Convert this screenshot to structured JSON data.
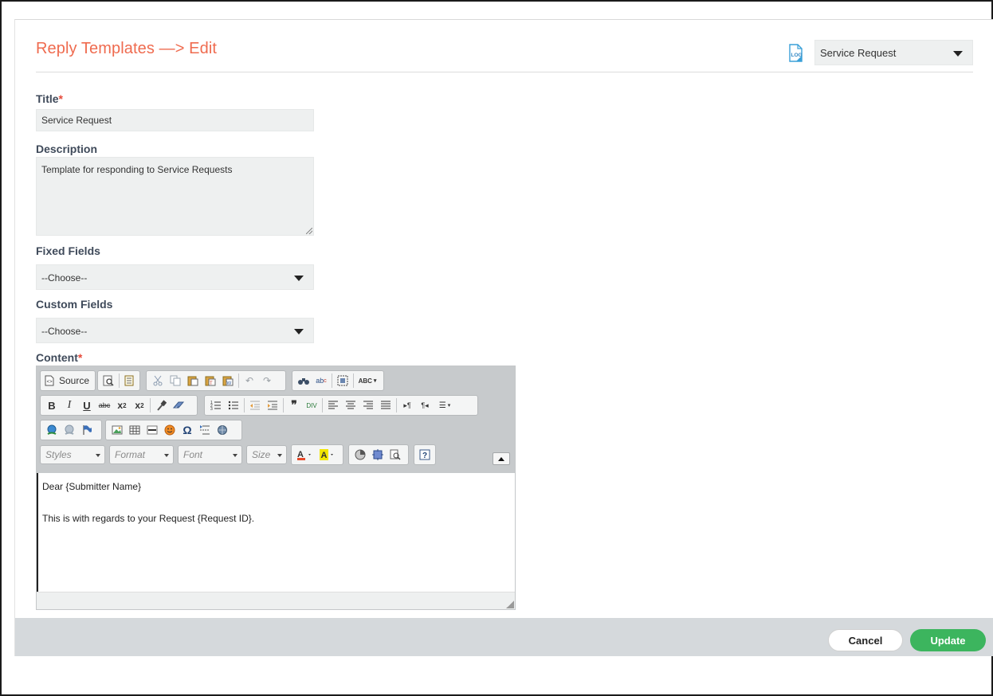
{
  "header": {
    "title": "Reply Templates —> Edit",
    "template_select_value": "Service Request"
  },
  "form": {
    "title_label": "Title",
    "title_value": "Service Request",
    "description_label": "Description",
    "description_value": "Template for responding to Service Requests",
    "fixed_fields_label": "Fixed Fields",
    "fixed_fields_value": "--Choose--",
    "custom_fields_label": "Custom Fields",
    "custom_fields_value": "--Choose--",
    "content_label": "Content",
    "required_mark": "*"
  },
  "editor": {
    "source_label": "Source",
    "styles_placeholder": "Styles",
    "format_placeholder": "Format",
    "font_placeholder": "Font",
    "size_placeholder": "Size",
    "content_line1": "Dear  {Submitter Name}",
    "content_line2": "This is with regards to your  Request {Request ID}."
  },
  "footer": {
    "cancel_label": "Cancel",
    "update_label": "Update"
  },
  "colors": {
    "title_accent": "#ef6b4f",
    "required": "#e64b3c",
    "update_button": "#3cb55e",
    "footer_bar": "#d5d9dc",
    "toolbar_bg": "#c7cacc"
  }
}
